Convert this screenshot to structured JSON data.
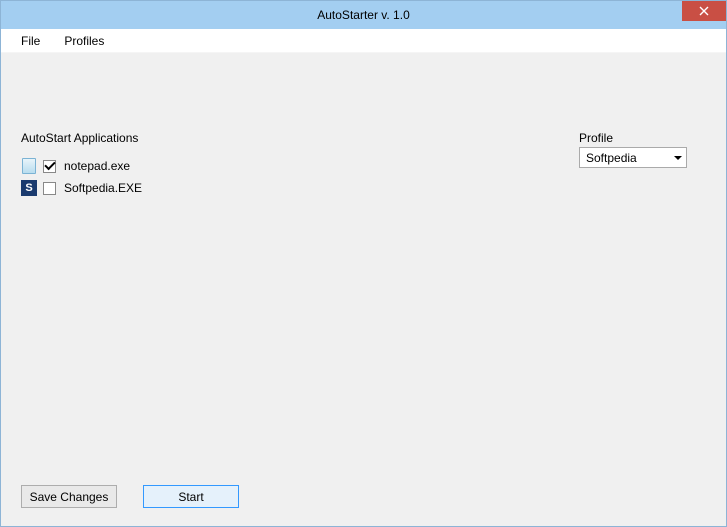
{
  "window": {
    "title": "AutoStarter v. 1.0"
  },
  "menu": {
    "file": "File",
    "profiles": "Profiles"
  },
  "labels": {
    "autostart": "AutoStart Applications",
    "profile": "Profile"
  },
  "profile": {
    "selected": "Softpedia"
  },
  "apps": {
    "items": [
      {
        "name": "notepad.exe",
        "checked": true,
        "icon": "notepad"
      },
      {
        "name": "Softpedia.EXE",
        "checked": false,
        "icon": "softpedia"
      }
    ]
  },
  "buttons": {
    "save": "Save Changes",
    "start": "Start"
  },
  "icons": {
    "softpedia_letter": "S"
  }
}
